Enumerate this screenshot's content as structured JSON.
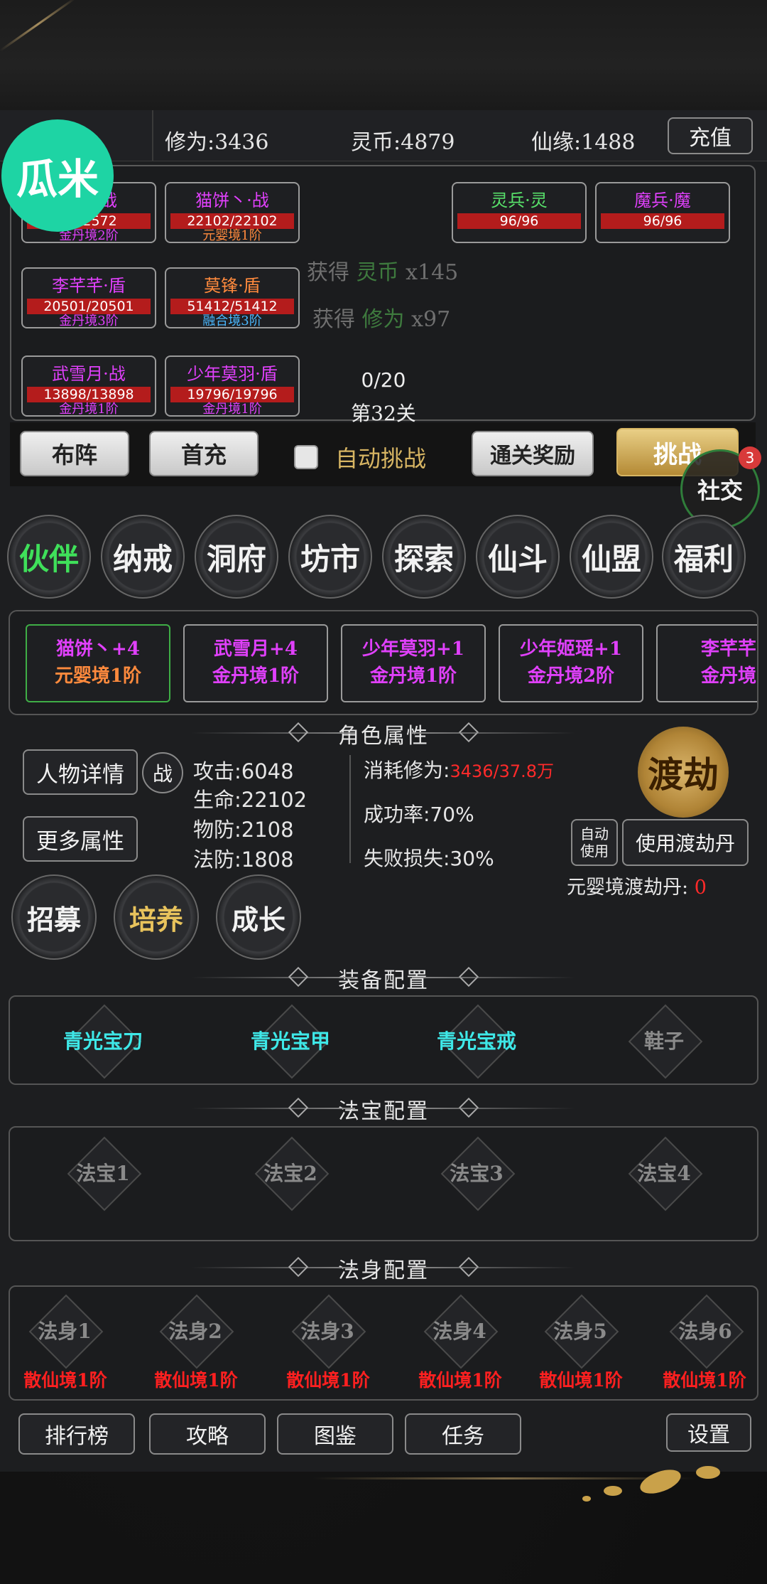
{
  "resources": {
    "cultivation": "修为:3436",
    "spirit_coin": "灵币:4879",
    "immortal_fate": "仙缘:1488",
    "recharge": "充值"
  },
  "logo": {
    "text": "瓜米"
  },
  "team": [
    {
      "name": "…瑶·战",
      "hp": "…12572",
      "realm": "金丹境2阶",
      "name_color": "#e040fb",
      "realm_color": "#e040fb"
    },
    {
      "name": "猫饼丶·战",
      "hp": "22102/22102",
      "realm": "元婴境1阶",
      "name_color": "#e040fb",
      "realm_color": "#ff8a3d"
    },
    {
      "name": "李芊芊·盾",
      "hp": "20501/20501",
      "realm": "金丹境3阶",
      "name_color": "#e040fb",
      "realm_color": "#e040fb"
    },
    {
      "name": "莫锋·盾",
      "hp": "51412/51412",
      "realm": "融合境3阶",
      "name_color": "#ff8a3d",
      "realm_color": "#4ab8ff"
    },
    {
      "name": "武雪月·战",
      "hp": "13898/13898",
      "realm": "金丹境1阶",
      "name_color": "#e040fb",
      "realm_color": "#e040fb"
    },
    {
      "name": "少年莫羽·盾",
      "hp": "19796/19796",
      "realm": "金丹境1阶",
      "name_color": "#e040fb",
      "realm_color": "#e040fb"
    }
  ],
  "enemies": [
    {
      "name": "灵兵·灵",
      "hp": "96/96",
      "name_color": "#58e06a"
    },
    {
      "name": "魔兵·魔",
      "hp": "96/96",
      "name_color": "#e040fb"
    }
  ],
  "loot": [
    {
      "prefix": "获得",
      "item": "灵币",
      "qty": "x145"
    },
    {
      "prefix": "获得",
      "item": "修为",
      "qty": "x97"
    }
  ],
  "stage": {
    "progress": "0/20",
    "level": "第32关"
  },
  "actions": {
    "formation": "布阵",
    "first_charge": "首充",
    "auto_label": "自动挑战",
    "clear_reward": "通关奖励",
    "challenge": "挑战"
  },
  "social": {
    "label": "社交",
    "badge": "3"
  },
  "nav": [
    "伙伴",
    "纳戒",
    "洞府",
    "坊市",
    "探索",
    "仙斗",
    "仙盟",
    "福利"
  ],
  "partners": [
    {
      "name": "猫饼丶+4",
      "realm": "元婴境1阶",
      "name_color": "#e040fb",
      "realm_color": "#ff8a3d"
    },
    {
      "name": "武雪月+4",
      "realm": "金丹境1阶",
      "name_color": "#e040fb",
      "realm_color": "#e040fb"
    },
    {
      "name": "少年莫羽+1",
      "realm": "金丹境1阶",
      "name_color": "#e040fb",
      "realm_color": "#e040fb"
    },
    {
      "name": "少年姬瑶+1",
      "realm": "金丹境2阶",
      "name_color": "#e040fb",
      "realm_color": "#e040fb"
    },
    {
      "name": "李芊芊",
      "realm": "金丹境",
      "name_color": "#e040fb",
      "realm_color": "#e040fb"
    }
  ],
  "attributes": {
    "title": "角色属性",
    "detail_btn": "人物详情",
    "war_btn": "战",
    "more_btn": "更多属性",
    "attack": "攻击:6048",
    "life": "生命:22102",
    "pdef": "物防:2108",
    "mdef": "法防:1808",
    "cost_label": "消耗修为:",
    "cost_value": "3436/37.8万",
    "success": "成功率:70%",
    "fail": "失败损失:30%",
    "tribulation": "渡劫",
    "auto_use": "自动使用",
    "use_pill": "使用渡劫丹",
    "pill_label": "元婴境渡劫丹:",
    "pill_count": "0"
  },
  "tabs": {
    "recruit": "招募",
    "train": "培养",
    "growth": "成长"
  },
  "equipment": {
    "title": "装备配置",
    "slots": [
      "青光宝刀",
      "青光宝甲",
      "青光宝戒",
      "鞋子"
    ]
  },
  "treasure": {
    "title": "法宝配置",
    "slots": [
      "法宝1",
      "法宝2",
      "法宝3",
      "法宝4"
    ]
  },
  "dharma": {
    "title": "法身配置",
    "slots": [
      {
        "name": "法身1",
        "realm": "散仙境1阶"
      },
      {
        "name": "法身2",
        "realm": "散仙境1阶"
      },
      {
        "name": "法身3",
        "realm": "散仙境1阶"
      },
      {
        "name": "法身4",
        "realm": "散仙境1阶"
      },
      {
        "name": "法身5",
        "realm": "散仙境1阶"
      },
      {
        "name": "法身6",
        "realm": "散仙境1阶"
      }
    ]
  },
  "bottom": {
    "ranking": "排行榜",
    "guide": "攻略",
    "codex": "图鉴",
    "tasks": "任务",
    "settings": "设置"
  },
  "colors": {
    "accent_green": "#3fe05a",
    "hp_red": "#b41c1c",
    "equip_cyan": "#3ee8e8",
    "gold": "#d7b563"
  }
}
